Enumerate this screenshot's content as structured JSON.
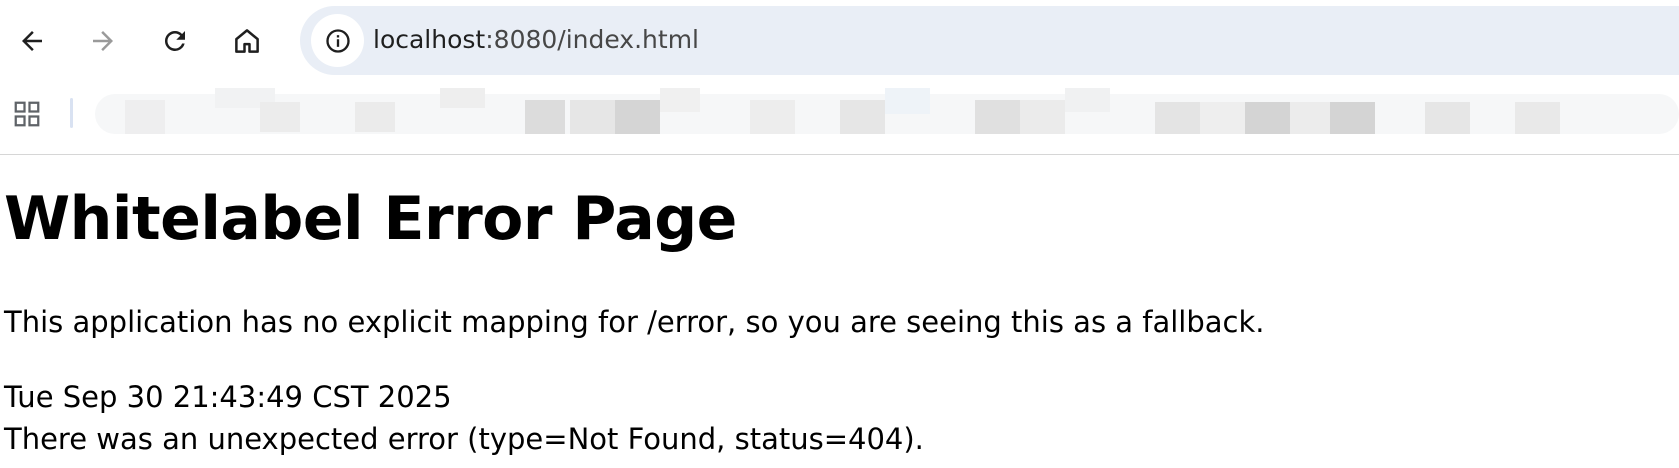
{
  "browser": {
    "url_host": "localhost",
    "url_rest": ":8080/index.html",
    "icons": {
      "back": "arrow-left-icon",
      "forward": "arrow-right-icon",
      "reload": "reload-icon",
      "home": "home-icon",
      "site_info": "info-icon",
      "apps": "apps-grid-icon"
    }
  },
  "page": {
    "title": "Whitelabel Error Page",
    "explanation": "This application has no explicit mapping for /error, so you are seeing this as a fallback.",
    "timestamp": "Tue Sep 30 21:43:49 CST 2025",
    "error_detail": "There was an unexpected error (type=Not Found, status=404)."
  }
}
